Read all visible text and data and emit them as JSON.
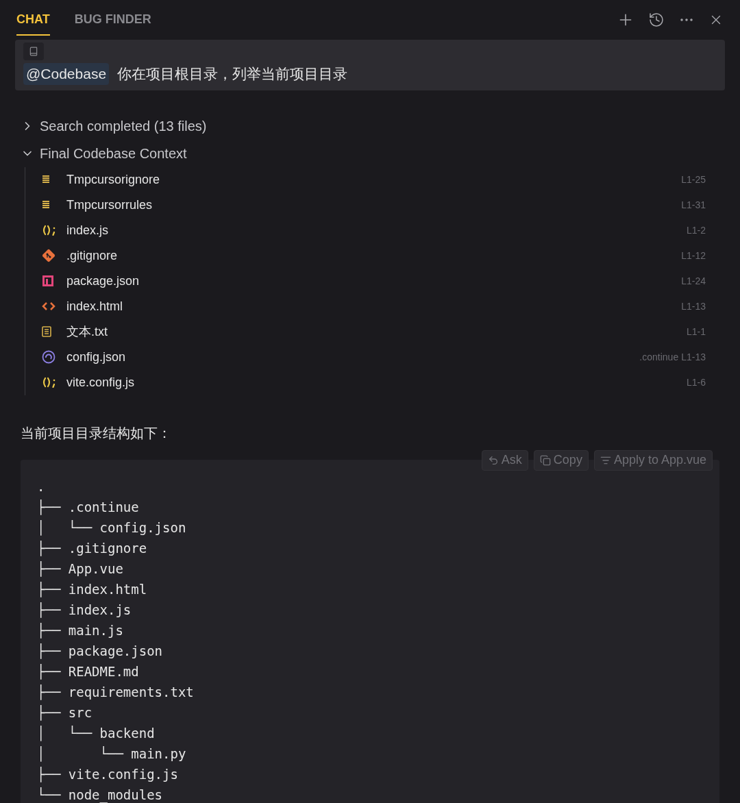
{
  "tabs": [
    {
      "label": "CHAT",
      "selected": true
    },
    {
      "label": "BUG FINDER",
      "selected": false
    }
  ],
  "message": {
    "mention": "@Codebase",
    "text": "你在项目根目录，列举当前项目目录"
  },
  "sections": [
    {
      "label": "Search completed (13 files)",
      "expanded": false
    },
    {
      "label": "Final Codebase Context",
      "expanded": true
    }
  ],
  "files": [
    {
      "kind": "lines",
      "name": "Tmpcursorignore",
      "range": "L1-25"
    },
    {
      "kind": "lines",
      "name": "Tmpcursorrules",
      "range": "L1-31"
    },
    {
      "kind": "js",
      "name": "index.js",
      "range": "L1-2"
    },
    {
      "kind": "git",
      "name": ".gitignore",
      "range": "L1-12"
    },
    {
      "kind": "npm",
      "name": "package.json",
      "range": "L1-24"
    },
    {
      "kind": "html",
      "name": "index.html",
      "range": "L1-13"
    },
    {
      "kind": "text",
      "name": "文本.txt",
      "range": "L1-1"
    },
    {
      "kind": "continue",
      "name": "config.json",
      "folder": ".continue",
      "range": "L1-13"
    },
    {
      "kind": "js",
      "name": "vite.config.js",
      "range": "L1-6"
    }
  ],
  "answer": "当前项目目录结构如下：",
  "code_actions": [
    {
      "kind": "ask",
      "label": "Ask"
    },
    {
      "kind": "copy",
      "label": "Copy"
    },
    {
      "kind": "apply",
      "label": "Apply to App.vue"
    }
  ],
  "code_lines": [
    ".",
    "├── .continue",
    "│   └── config.json",
    "├── .gitignore",
    "├── App.vue",
    "├── index.html",
    "├── index.js",
    "├── main.js",
    "├── package.json",
    "├── README.md",
    "├── requirements.txt",
    "├── src",
    "│   └── backend",
    "│       └── main.py",
    "├── vite.config.js",
    "└── node_modules"
  ]
}
